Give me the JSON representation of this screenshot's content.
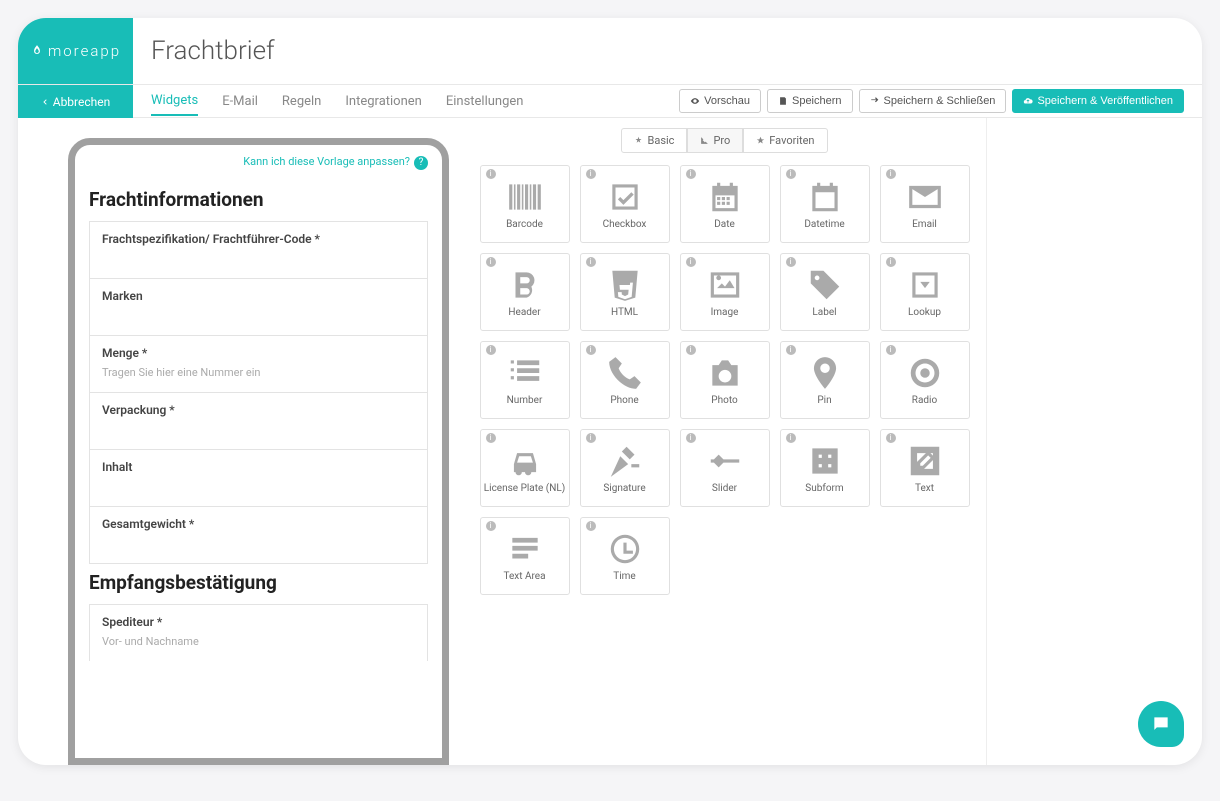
{
  "brand": "moreapp",
  "title": "Frachtbrief",
  "cancel": "Abbrechen",
  "tabs": [
    "Widgets",
    "E-Mail",
    "Regeln",
    "Integrationen",
    "Einstellungen"
  ],
  "actions": {
    "preview": "Vorschau",
    "save": "Speichern",
    "save_close": "Speichern & Schließen",
    "save_publish": "Speichern & Veröffentlichen"
  },
  "help_link": "Kann ich diese Vorlage anpassen?",
  "sections": [
    {
      "title": "Frachtinformationen",
      "fields": [
        {
          "label": "Frachtspezifikation/ Frachtführer-Code *",
          "placeholder": ""
        },
        {
          "label": "Marken",
          "placeholder": ""
        },
        {
          "label": "Menge *",
          "placeholder": "Tragen Sie hier eine Nummer ein"
        },
        {
          "label": "Verpackung *",
          "placeholder": ""
        },
        {
          "label": "Inhalt",
          "placeholder": ""
        },
        {
          "label": "Gesamtgewicht *",
          "placeholder": ""
        }
      ]
    },
    {
      "title": "Empfangsbestätigung",
      "fields": [
        {
          "label": "Spediteur *",
          "placeholder": "Vor- und Nachname"
        }
      ]
    }
  ],
  "segments": [
    "Basic",
    "Pro",
    "Favoriten"
  ],
  "widgets": [
    {
      "name": "Barcode",
      "icon": "barcode"
    },
    {
      "name": "Checkbox",
      "icon": "checkbox"
    },
    {
      "name": "Date",
      "icon": "calendar"
    },
    {
      "name": "Datetime",
      "icon": "calendar-empty"
    },
    {
      "name": "Email",
      "icon": "envelope"
    },
    {
      "name": "Header",
      "icon": "bold"
    },
    {
      "name": "HTML",
      "icon": "html5"
    },
    {
      "name": "Image",
      "icon": "image"
    },
    {
      "name": "Label",
      "icon": "tag"
    },
    {
      "name": "Lookup",
      "icon": "dropdown"
    },
    {
      "name": "Number",
      "icon": "numbered-list"
    },
    {
      "name": "Phone",
      "icon": "phone"
    },
    {
      "name": "Photo",
      "icon": "camera"
    },
    {
      "name": "Pin",
      "icon": "pin"
    },
    {
      "name": "Radio",
      "icon": "radio"
    },
    {
      "name": "License Plate (NL)",
      "icon": "car"
    },
    {
      "name": "Signature",
      "icon": "gavel"
    },
    {
      "name": "Slider",
      "icon": "slider"
    },
    {
      "name": "Subform",
      "icon": "plus-square"
    },
    {
      "name": "Text",
      "icon": "pencil-square"
    },
    {
      "name": "Text Area",
      "icon": "lines"
    },
    {
      "name": "Time",
      "icon": "clock"
    }
  ]
}
